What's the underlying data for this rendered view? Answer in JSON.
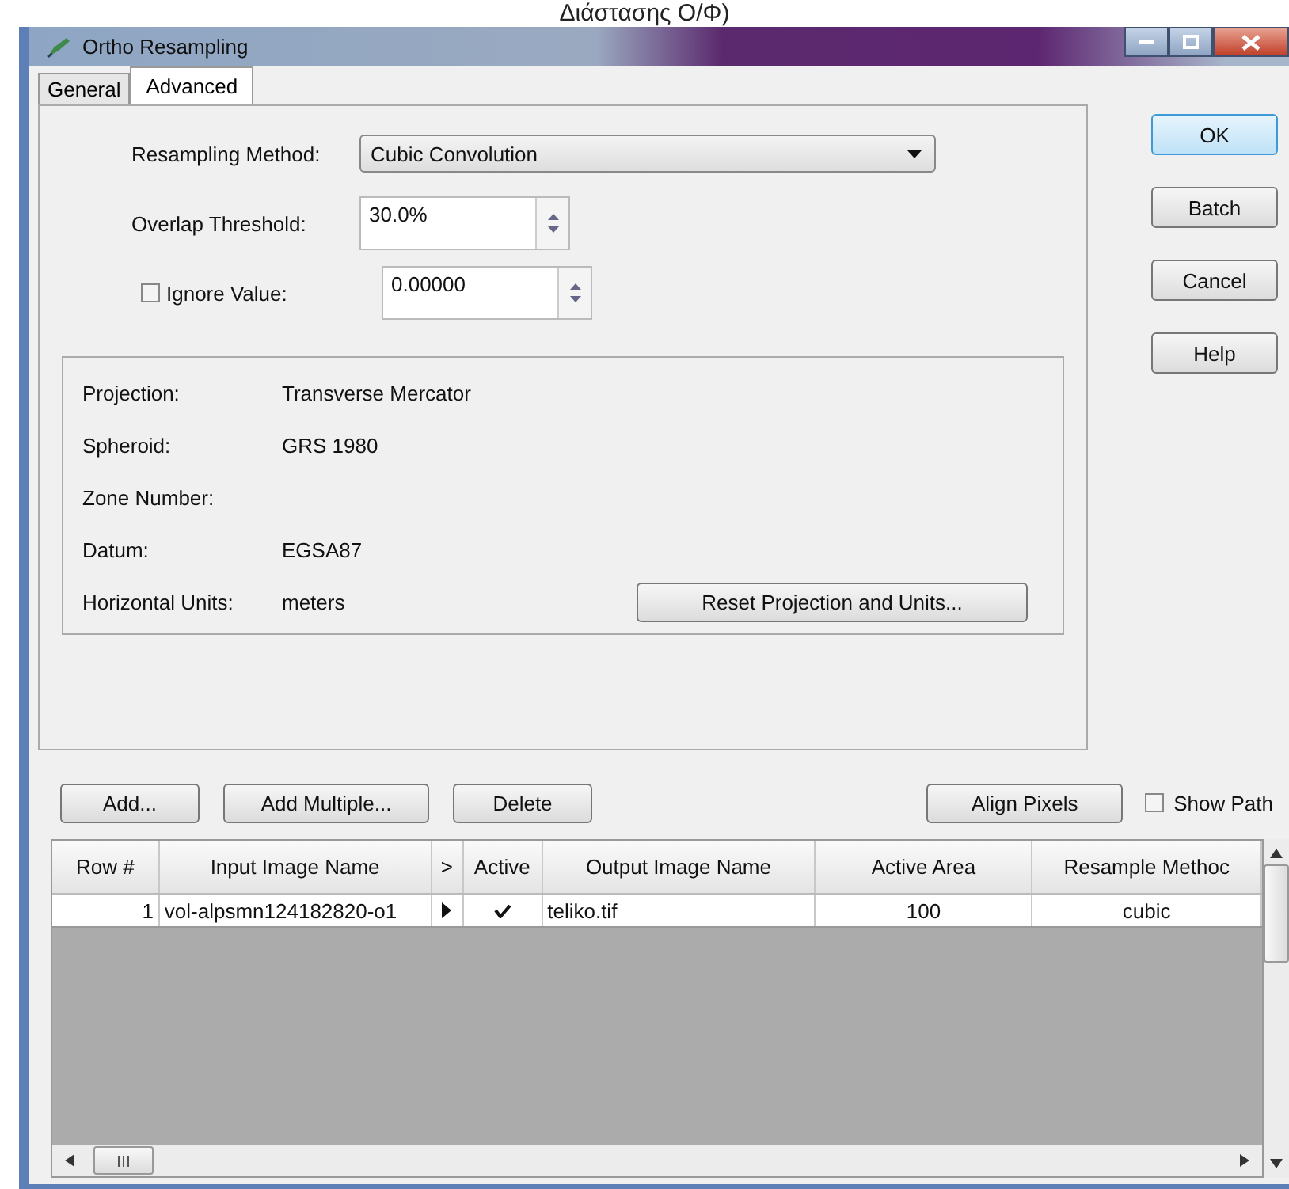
{
  "caption": "Διάστασης Ο/Φ)",
  "window": {
    "title": "Ortho Resampling"
  },
  "tabs": [
    {
      "label": "General",
      "selected": false
    },
    {
      "label": "Advanced",
      "selected": true
    }
  ],
  "settings": [
    {
      "kind": "dropdown",
      "label": "Resampling Method:",
      "value": "Cubic Convolution"
    },
    {
      "kind": "spinner",
      "label": "Overlap Threshold:",
      "value": "30.0%"
    },
    {
      "kind": "check-spinner",
      "label": "Ignore Value:",
      "checked": false,
      "value": "0.00000"
    }
  ],
  "projection": [
    {
      "label": "Projection:",
      "value": "Transverse Mercator"
    },
    {
      "label": "Spheroid:",
      "value": "GRS 1980"
    },
    {
      "label": "Zone Number:"
    },
    {
      "label": "Datum:",
      "value": "EGSA87"
    },
    {
      "label": "Horizontal Units:",
      "value": "meters"
    }
  ],
  "reset_button": "Reset Projection and Units...",
  "side_buttons": [
    {
      "label": "OK",
      "default": true
    },
    {
      "label": "Batch",
      "default": false
    },
    {
      "label": "Cancel",
      "default": false
    },
    {
      "label": "Help",
      "default": false
    }
  ],
  "list_buttons": [
    "Add...",
    "Add Multiple...",
    "Delete"
  ],
  "align_button": "Align Pixels",
  "show_path": {
    "label": "Show Path",
    "checked": false
  },
  "table": {
    "columns": [
      "Row #",
      "Input Image Name",
      ">",
      "Active",
      "Output Image Name",
      "Active Area",
      "Resample Methoc"
    ],
    "rows": [
      {
        "row": "1",
        "input": "vol-alpsmn124182820-o1",
        "current": true,
        "active": true,
        "output": "teliko.tif",
        "area": "100",
        "method": "cubic"
      }
    ]
  }
}
